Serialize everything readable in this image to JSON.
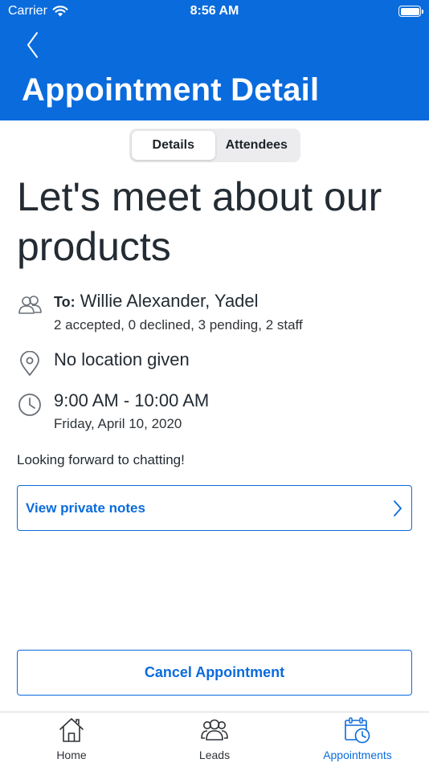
{
  "status_bar": {
    "carrier": "Carrier",
    "time": "8:56 AM"
  },
  "header": {
    "title": "Appointment Detail"
  },
  "segments": [
    {
      "label": "Details",
      "active": true
    },
    {
      "label": "Attendees",
      "active": false
    }
  ],
  "appointment": {
    "title": "Let's meet about our products",
    "to_label": "To:",
    "attendees": "Willie Alexander, Yadel",
    "rsvp_summary": "2 accepted, 0 declined, 3 pending, 2 staff",
    "location": "No location given",
    "time_range": "9:00 AM - 10:00 AM",
    "date": "Friday, April 10, 2020",
    "description": "Looking forward to chatting!"
  },
  "actions": {
    "view_notes": "View private notes",
    "cancel": "Cancel Appointment"
  },
  "tabbar": [
    {
      "label": "Home",
      "icon": "home-icon",
      "active": false
    },
    {
      "label": "Leads",
      "icon": "leads-icon",
      "active": false
    },
    {
      "label": "Appointments",
      "icon": "calendar-clock-icon",
      "active": true
    }
  ],
  "colors": {
    "brand": "#0a6bdc",
    "text": "#232b33",
    "icon_gray": "#6b7178"
  }
}
